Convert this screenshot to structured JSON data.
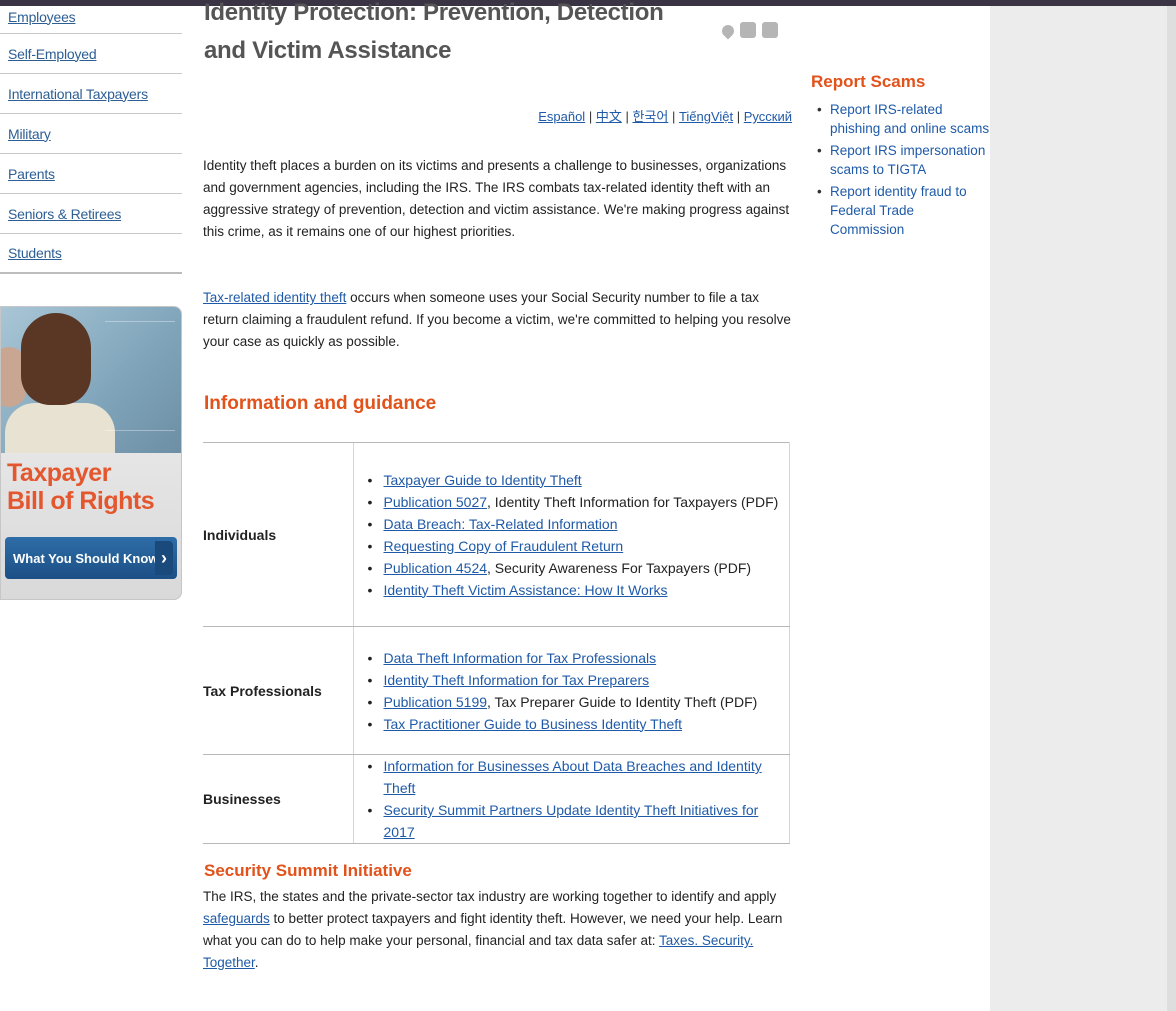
{
  "leftnav": {
    "items": [
      {
        "label": "Employees"
      },
      {
        "label": "Self-Employed"
      },
      {
        "label": "International Taxpayers"
      },
      {
        "label": "Military"
      },
      {
        "label": "Parents"
      },
      {
        "label": "Seniors & Retirees"
      },
      {
        "label": "Students"
      }
    ]
  },
  "promo": {
    "title_line1": "Taxpayer",
    "title_line2": "Bill of Rights",
    "button_label": "What You Should Know",
    "button_chevron": "›"
  },
  "page": {
    "title_line1": "Identity Protection: Prevention, Detection",
    "title_line2": "and Victim Assistance",
    "toolbar_icons": [
      "heart-icon",
      "share-icon",
      "print-icon"
    ]
  },
  "languages": {
    "items": [
      "Español",
      "中文",
      "한국어",
      "TiếngViệt",
      "Русский"
    ],
    "separator": " | "
  },
  "intro": {
    "p1": "Identity theft places a burden on its victims and presents a challenge to businesses, organizations and government agencies, including the IRS. The IRS combats tax-related identity theft with an aggressive strategy of prevention, detection and victim assistance. We're making progress against this crime, as it remains one of our highest priorities.",
    "p2_link": "Tax-related identity theft",
    "p2_text": " occurs when someone uses your Social Security number to file a tax return claiming a fraudulent refund. If you become a victim, we're committed to helping you resolve your case as quickly as possible."
  },
  "guidance": {
    "heading": "Information and guidance",
    "individuals": {
      "label": "Individuals",
      "items": [
        {
          "link": "Taxpayer Guide to Identity Theft",
          "text": ""
        },
        {
          "link": "Publication 5027",
          "text": ", Identity Theft Information for Taxpayers (PDF)"
        },
        {
          "link": "Data Breach: Tax-Related Information",
          "text": ""
        },
        {
          "link": "Requesting Copy of Fraudulent Return",
          "text": ""
        },
        {
          "link": "Publication 4524",
          "text": ", Security Awareness For Taxpayers (PDF)"
        },
        {
          "link": "Identity Theft Victim Assistance: How It Works",
          "text": ""
        }
      ]
    },
    "tax_professionals": {
      "label": "Tax Professionals",
      "items": [
        {
          "link": "Data Theft Information for Tax Professionals",
          "text": ""
        },
        {
          "link": "Identity Theft Information for Tax Preparers",
          "text": ""
        },
        {
          "link": "Publication 5199",
          "text": ", Tax Preparer Guide to Identity Theft (PDF)"
        },
        {
          "link": "Tax Practitioner Guide to Business Identity Theft",
          "text": ""
        }
      ]
    },
    "businesses": {
      "label": "Businesses",
      "items": [
        {
          "link": "Information for Businesses About Data Breaches and Identity Theft",
          "text": ""
        },
        {
          "link": "Security Summit Partners Update Identity Theft Initiatives for 2017",
          "text": ""
        }
      ]
    }
  },
  "summit": {
    "heading": "Security Summit Initiative",
    "text1": "The IRS, the states and the private-sector tax industry are working together to identify and apply ",
    "link1": "safeguards",
    "text2": " to better protect taxpayers and fight identity theft. However, we need your help. Learn what you can do to help make your personal, financial and tax data safer at: ",
    "link2": "Taxes. Security. Together",
    "text3": "."
  },
  "report": {
    "heading": "Report Scams",
    "items": [
      "Report IRS-related phishing and online scams",
      "Report IRS impersonation scams to TIGTA",
      "Report identity fraud to Federal Trade Commission"
    ]
  }
}
